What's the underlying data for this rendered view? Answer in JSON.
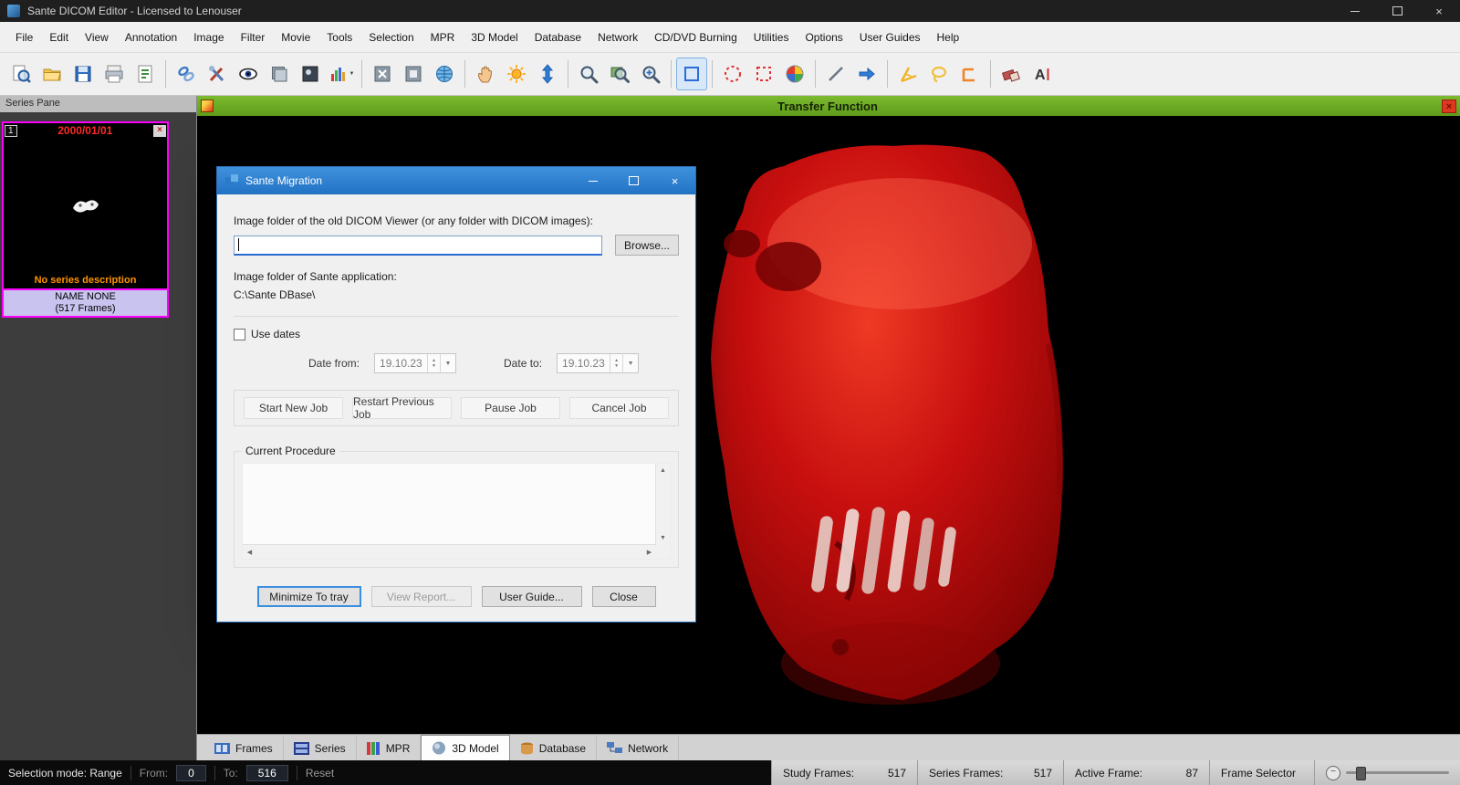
{
  "window": {
    "title": "Sante DICOM Editor - Licensed to Lenouser"
  },
  "menu": {
    "items": [
      "File",
      "Edit",
      "View",
      "Annotation",
      "Image",
      "Filter",
      "Movie",
      "Tools",
      "Selection",
      "MPR",
      "3D Model",
      "Database",
      "Network",
      "CD/DVD Burning",
      "Utilities",
      "Options",
      "User Guides",
      "Help"
    ]
  },
  "toolbar": {
    "icons": [
      {
        "name": "print-preview-icon",
        "shape": "page-magnifier"
      },
      {
        "name": "open-folder-icon",
        "shape": "folder"
      },
      {
        "name": "save-icon",
        "shape": "save"
      },
      {
        "name": "print-icon",
        "shape": "printer"
      },
      {
        "name": "report-icon",
        "shape": "report"
      },
      {
        "sep": true
      },
      {
        "name": "link-series-icon",
        "shape": "chain"
      },
      {
        "name": "tools-icon",
        "shape": "wrench"
      },
      {
        "name": "view-eye-icon",
        "shape": "eye"
      },
      {
        "name": "stack-icon",
        "shape": "stack"
      },
      {
        "name": "window-level-icon",
        "shape": "image"
      },
      {
        "name": "histogram-icon",
        "shape": "histogram",
        "dropdown": true
      },
      {
        "sep": true
      },
      {
        "name": "fit-to-window-icon",
        "shape": "fit"
      },
      {
        "name": "actual-size-icon",
        "shape": "fit2"
      },
      {
        "name": "globe-icon",
        "shape": "globe"
      },
      {
        "sep": true
      },
      {
        "name": "pan-hand-icon",
        "shape": "hand"
      },
      {
        "name": "brightness-icon",
        "shape": "sun"
      },
      {
        "name": "scroll-frames-icon",
        "shape": "varrow"
      },
      {
        "sep": true
      },
      {
        "name": "zoom-icon",
        "shape": "magnifier"
      },
      {
        "name": "zoom-region-icon",
        "shape": "magnifier-image"
      },
      {
        "name": "magnify-glass-icon",
        "shape": "magnifier-plus"
      },
      {
        "sep": true
      },
      {
        "name": "rect-select-icon",
        "shape": "rect-select",
        "selected": true
      },
      {
        "sep": true
      },
      {
        "name": "ellipse-select-icon",
        "shape": "ellipse-dashed"
      },
      {
        "name": "freehand-select-icon",
        "shape": "rect-dashed"
      },
      {
        "name": "color-select-icon",
        "shape": "color-wheel"
      },
      {
        "sep": true
      },
      {
        "name": "ruler-icon",
        "shape": "line"
      },
      {
        "name": "arrow-annotation-icon",
        "shape": "arrow"
      },
      {
        "sep": true
      },
      {
        "name": "angle-icon",
        "shape": "angle"
      },
      {
        "name": "curve-icon",
        "shape": "lasso"
      },
      {
        "name": "corner-measure-icon",
        "shape": "corner"
      },
      {
        "sep": true
      },
      {
        "name": "eraser-icon",
        "shape": "eraser"
      },
      {
        "name": "text-annotation-icon",
        "shape": "text"
      }
    ]
  },
  "series_pane": {
    "header": "Series Pane",
    "thumb_index": "1",
    "date": "2000/01/01",
    "no_description": "No series description",
    "patient_name": "NAME NONE",
    "frames": "(517 Frames)"
  },
  "viewport": {
    "title": "Transfer Function",
    "close": "×"
  },
  "dialog": {
    "title": "Sante Migration",
    "label_old_folder": "Image folder of the old DICOM Viewer (or any folder with DICOM images):",
    "browse": "Browse...",
    "label_sante_folder": "Image folder of Sante application:",
    "sante_path": "C:\\Sante DBase\\",
    "use_dates": "Use dates",
    "date_from_label": "Date from:",
    "date_to_label": "Date to:",
    "date_from": "19.10.23",
    "date_to": "19.10.23",
    "btn_start": "Start New Job",
    "btn_restart": "Restart Previous Job",
    "btn_pause": "Pause Job",
    "btn_cancel": "Cancel Job",
    "current_procedure": "Current Procedure",
    "btn_minimize_tray": "Minimize To tray",
    "btn_view_report": "View Report...",
    "btn_user_guide": "User Guide...",
    "btn_close": "Close"
  },
  "tabs": {
    "items": [
      {
        "label": "Frames"
      },
      {
        "label": "Series"
      },
      {
        "label": "MPR"
      },
      {
        "label": "3D Model",
        "active": true
      },
      {
        "label": "Database"
      },
      {
        "label": "Network"
      }
    ]
  },
  "status": {
    "selection_mode": "Selection mode: Range",
    "from_label": "From:",
    "from_value": "0",
    "to_label": "To:",
    "to_value": "516",
    "reset": "Reset",
    "study_frames_label": "Study Frames:",
    "study_frames": "517",
    "series_frames_label": "Series Frames:",
    "series_frames": "517",
    "active_frame_label": "Active Frame:",
    "active_frame": "87",
    "frame_selector_label": "Frame Selector"
  },
  "colors": {
    "accent_blue": "#2272c4",
    "viewport_green": "#6aa622",
    "series_border_magenta": "#ff00ff",
    "skull_red": "#c80f0f"
  }
}
